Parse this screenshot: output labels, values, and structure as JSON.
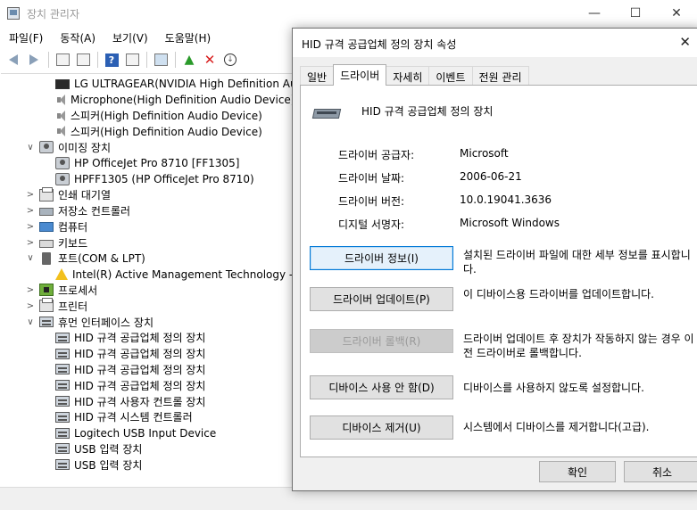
{
  "main_window": {
    "title": "장치 관리자",
    "controls": {
      "minimize": "—",
      "maximize": "☐",
      "close": "✕"
    },
    "menu": [
      "파일(F)",
      "동작(A)",
      "보기(V)",
      "도움말(H)"
    ],
    "toolbar_icons": [
      "back-icon",
      "forward-icon",
      "properties-icon",
      "show-hide-icon",
      "help-icon",
      "view-icon",
      "monitor-icon",
      "update-driver-icon",
      "uninstall-icon",
      "scan-icon"
    ]
  },
  "tree": [
    {
      "label": "LG ULTRAGEAR(NVIDIA High Definition Audio",
      "icon": "monitor",
      "level": 2
    },
    {
      "label": "Microphone(High Definition Audio Device)",
      "icon": "speaker",
      "level": 2
    },
    {
      "label": "스피커(High Definition Audio Device)",
      "icon": "speaker",
      "level": 2
    },
    {
      "label": "스피커(High Definition Audio Device)",
      "icon": "speaker",
      "level": 2
    },
    {
      "label": "이미징 장치",
      "icon": "camera",
      "level": 1,
      "expander": "∨"
    },
    {
      "label": "HP OfficeJet Pro 8710 [FF1305]",
      "icon": "camera",
      "level": 2
    },
    {
      "label": "HPFF1305 (HP OfficeJet Pro 8710)",
      "icon": "camera",
      "level": 2
    },
    {
      "label": "인쇄 대기열",
      "icon": "printer",
      "level": 1,
      "expander": ">"
    },
    {
      "label": "저장소 컨트롤러",
      "icon": "disk",
      "level": 1,
      "expander": ">"
    },
    {
      "label": "컴퓨터",
      "icon": "computer",
      "level": 1,
      "expander": ">"
    },
    {
      "label": "키보드",
      "icon": "keyboard",
      "level": 1,
      "expander": ">"
    },
    {
      "label": "포트(COM & LPT)",
      "icon": "port",
      "level": 1,
      "expander": "∨"
    },
    {
      "label": "Intel(R) Active Management Technology - SO",
      "icon": "warn",
      "level": 2
    },
    {
      "label": "프로세서",
      "icon": "cpu",
      "level": 1,
      "expander": ">"
    },
    {
      "label": "프린터",
      "icon": "printer",
      "level": 1,
      "expander": ">"
    },
    {
      "label": "휴먼 인터페이스 장치",
      "icon": "hid",
      "level": 1,
      "expander": "∨"
    },
    {
      "label": "HID 규격 공급업체 정의 장치",
      "icon": "hid",
      "level": 2
    },
    {
      "label": "HID 규격 공급업체 정의 장치",
      "icon": "hid",
      "level": 2
    },
    {
      "label": "HID 규격 공급업체 정의 장치",
      "icon": "hid",
      "level": 2
    },
    {
      "label": "HID 규격 공급업체 정의 장치",
      "icon": "hid",
      "level": 2
    },
    {
      "label": "HID 규격 사용자 컨트롤 장치",
      "icon": "hid",
      "level": 2
    },
    {
      "label": "HID 규격 시스템 컨트롤러",
      "icon": "hid",
      "level": 2
    },
    {
      "label": "Logitech USB Input Device",
      "icon": "hid",
      "level": 2
    },
    {
      "label": "USB 입력 장치",
      "icon": "hid",
      "level": 2
    },
    {
      "label": "USB 입력 장치",
      "icon": "hid",
      "level": 2
    }
  ],
  "dialog": {
    "title": "HID 규격 공급업체 정의 장치 속성",
    "close": "✕",
    "tabs": [
      "일반",
      "드라이버",
      "자세히",
      "이벤트",
      "전원 관리"
    ],
    "active_tab": 1,
    "device_name": "HID 규격 공급업체 정의 장치",
    "properties": [
      {
        "label": "드라이버 공급자:",
        "value": "Microsoft"
      },
      {
        "label": "드라이버 날짜:",
        "value": "2006-06-21"
      },
      {
        "label": "드라이버 버전:",
        "value": "10.0.19041.3636"
      },
      {
        "label": "디지털 서명자:",
        "value": "Microsoft Windows"
      }
    ],
    "actions": [
      {
        "button": "드라이버 정보(I)",
        "desc": "설치된 드라이버 파일에 대한 세부 정보를 표시합니다.",
        "state": "focused"
      },
      {
        "button": "드라이버 업데이트(P)",
        "desc": "이 디바이스용 드라이버를 업데이트합니다.",
        "state": "normal"
      },
      {
        "button": "드라이버 롤백(R)",
        "desc": "드라이버 업데이트 후 장치가 작동하지 않는 경우 이전 드라이버로 롤백합니다.",
        "state": "disabled"
      },
      {
        "button": "디바이스 사용 안 함(D)",
        "desc": "디바이스를 사용하지 않도록 설정합니다.",
        "state": "normal"
      },
      {
        "button": "디바이스 제거(U)",
        "desc": "시스템에서 디바이스를 제거합니다(고급).",
        "state": "normal"
      }
    ],
    "ok": "확인",
    "cancel": "취소"
  }
}
